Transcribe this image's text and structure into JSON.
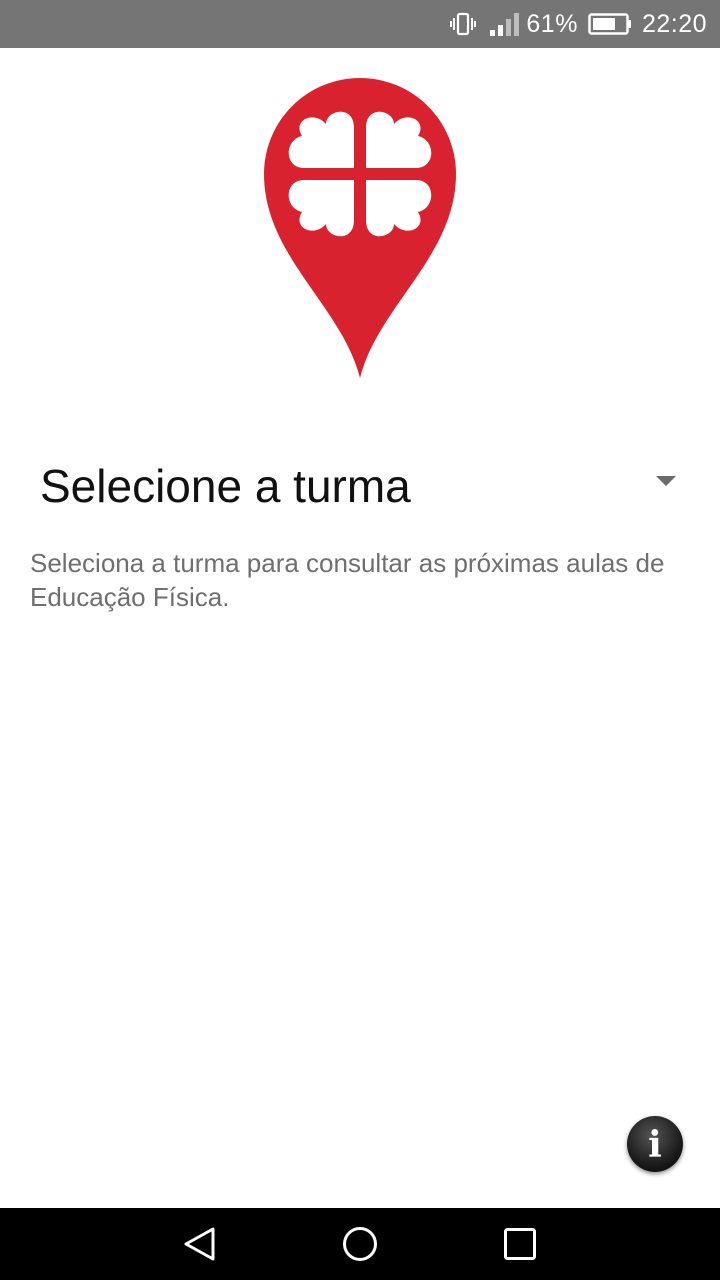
{
  "status_bar": {
    "battery_percent": "61%",
    "time": "22:20",
    "icons": [
      "vibrate-icon",
      "signal-icon",
      "battery-icon"
    ]
  },
  "logo": {
    "icon": "map-pin-clover-logo",
    "color": "#d9222f"
  },
  "spinner": {
    "selected_value": "Selecione a turma",
    "icon": "dropdown-arrow-icon"
  },
  "description": "Seleciona a turma para consultar as próximas aulas de Educação Física.",
  "info_button": {
    "glyph": "i",
    "icon": "info-icon"
  },
  "nav_bar": {
    "buttons": [
      "back-icon",
      "home-icon",
      "recents-icon"
    ]
  },
  "colors": {
    "status_bar_bg": "#757575",
    "brand_red": "#d9222f",
    "description_text": "#6f6f6f",
    "nav_bar_bg": "#000000"
  }
}
